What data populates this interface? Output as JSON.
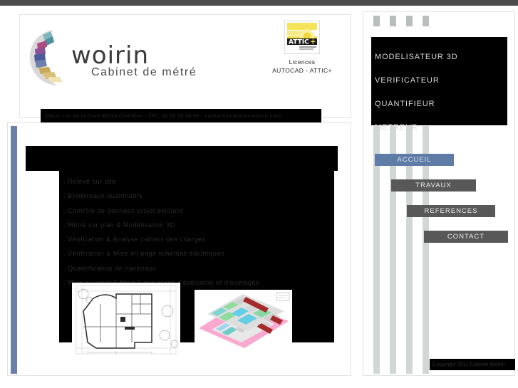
{
  "page": {
    "title": "Cabinet Woirin - Cabinet de metre",
    "accent_blue": "#6b7fa8",
    "active_nav_color": "#5e7ca6",
    "nav_color": "#585858",
    "black": "#000000",
    "chrome_bar_color": "#4d4d4d"
  },
  "header": {
    "brand_name": "woirin",
    "brand_tagline": "Cabinet de métré",
    "licence_caption_1": "Licences",
    "licence_caption_2": "AUTOCAD - ATTIC+",
    "attic_logo_text": "ATTIC",
    "attic_logo_plus": "+",
    "address_band": "30bis, rue de la Gare 92320 Châtillon - Tél : 06 26 52 45 96 - contact@cabinet-woirin.com"
  },
  "content": {
    "title_bar_text": "",
    "services": [
      ". Relevé sur site",
      ". Bordereaux quantitatifs",
      ". Contrôle de données projet existant",
      ". Métré sur plan & Modélisation 3D",
      ". Vérification & Analyse cahiers des charges",
      ". Vérification & Mise en page schémas électriques",
      ". Quantification de matériaux",
      ". Mise au point & Mise à jour plans d'exécution et d'ouvrages"
    ],
    "images": [
      {
        "name": "architectural-floor-plan",
        "alt": "Plan d'architecte 2D"
      },
      {
        "name": "building-3d-model",
        "alt": "Modélisation 3D du bâtiment"
      }
    ]
  },
  "sidebar": {
    "roles": [
      "MODELISATEUR  3D",
      "VERIFICATEUR",
      "QUANTIFIEUR",
      "METREUR"
    ],
    "nav": [
      {
        "label": "ACCUEIL",
        "active": true
      },
      {
        "label": "TRAVAUX",
        "active": false
      },
      {
        "label": "REFERENCES",
        "active": false
      },
      {
        "label": "CONTACT",
        "active": false
      }
    ],
    "copyright": "Copyright 2011 Cabinet Woirin"
  }
}
